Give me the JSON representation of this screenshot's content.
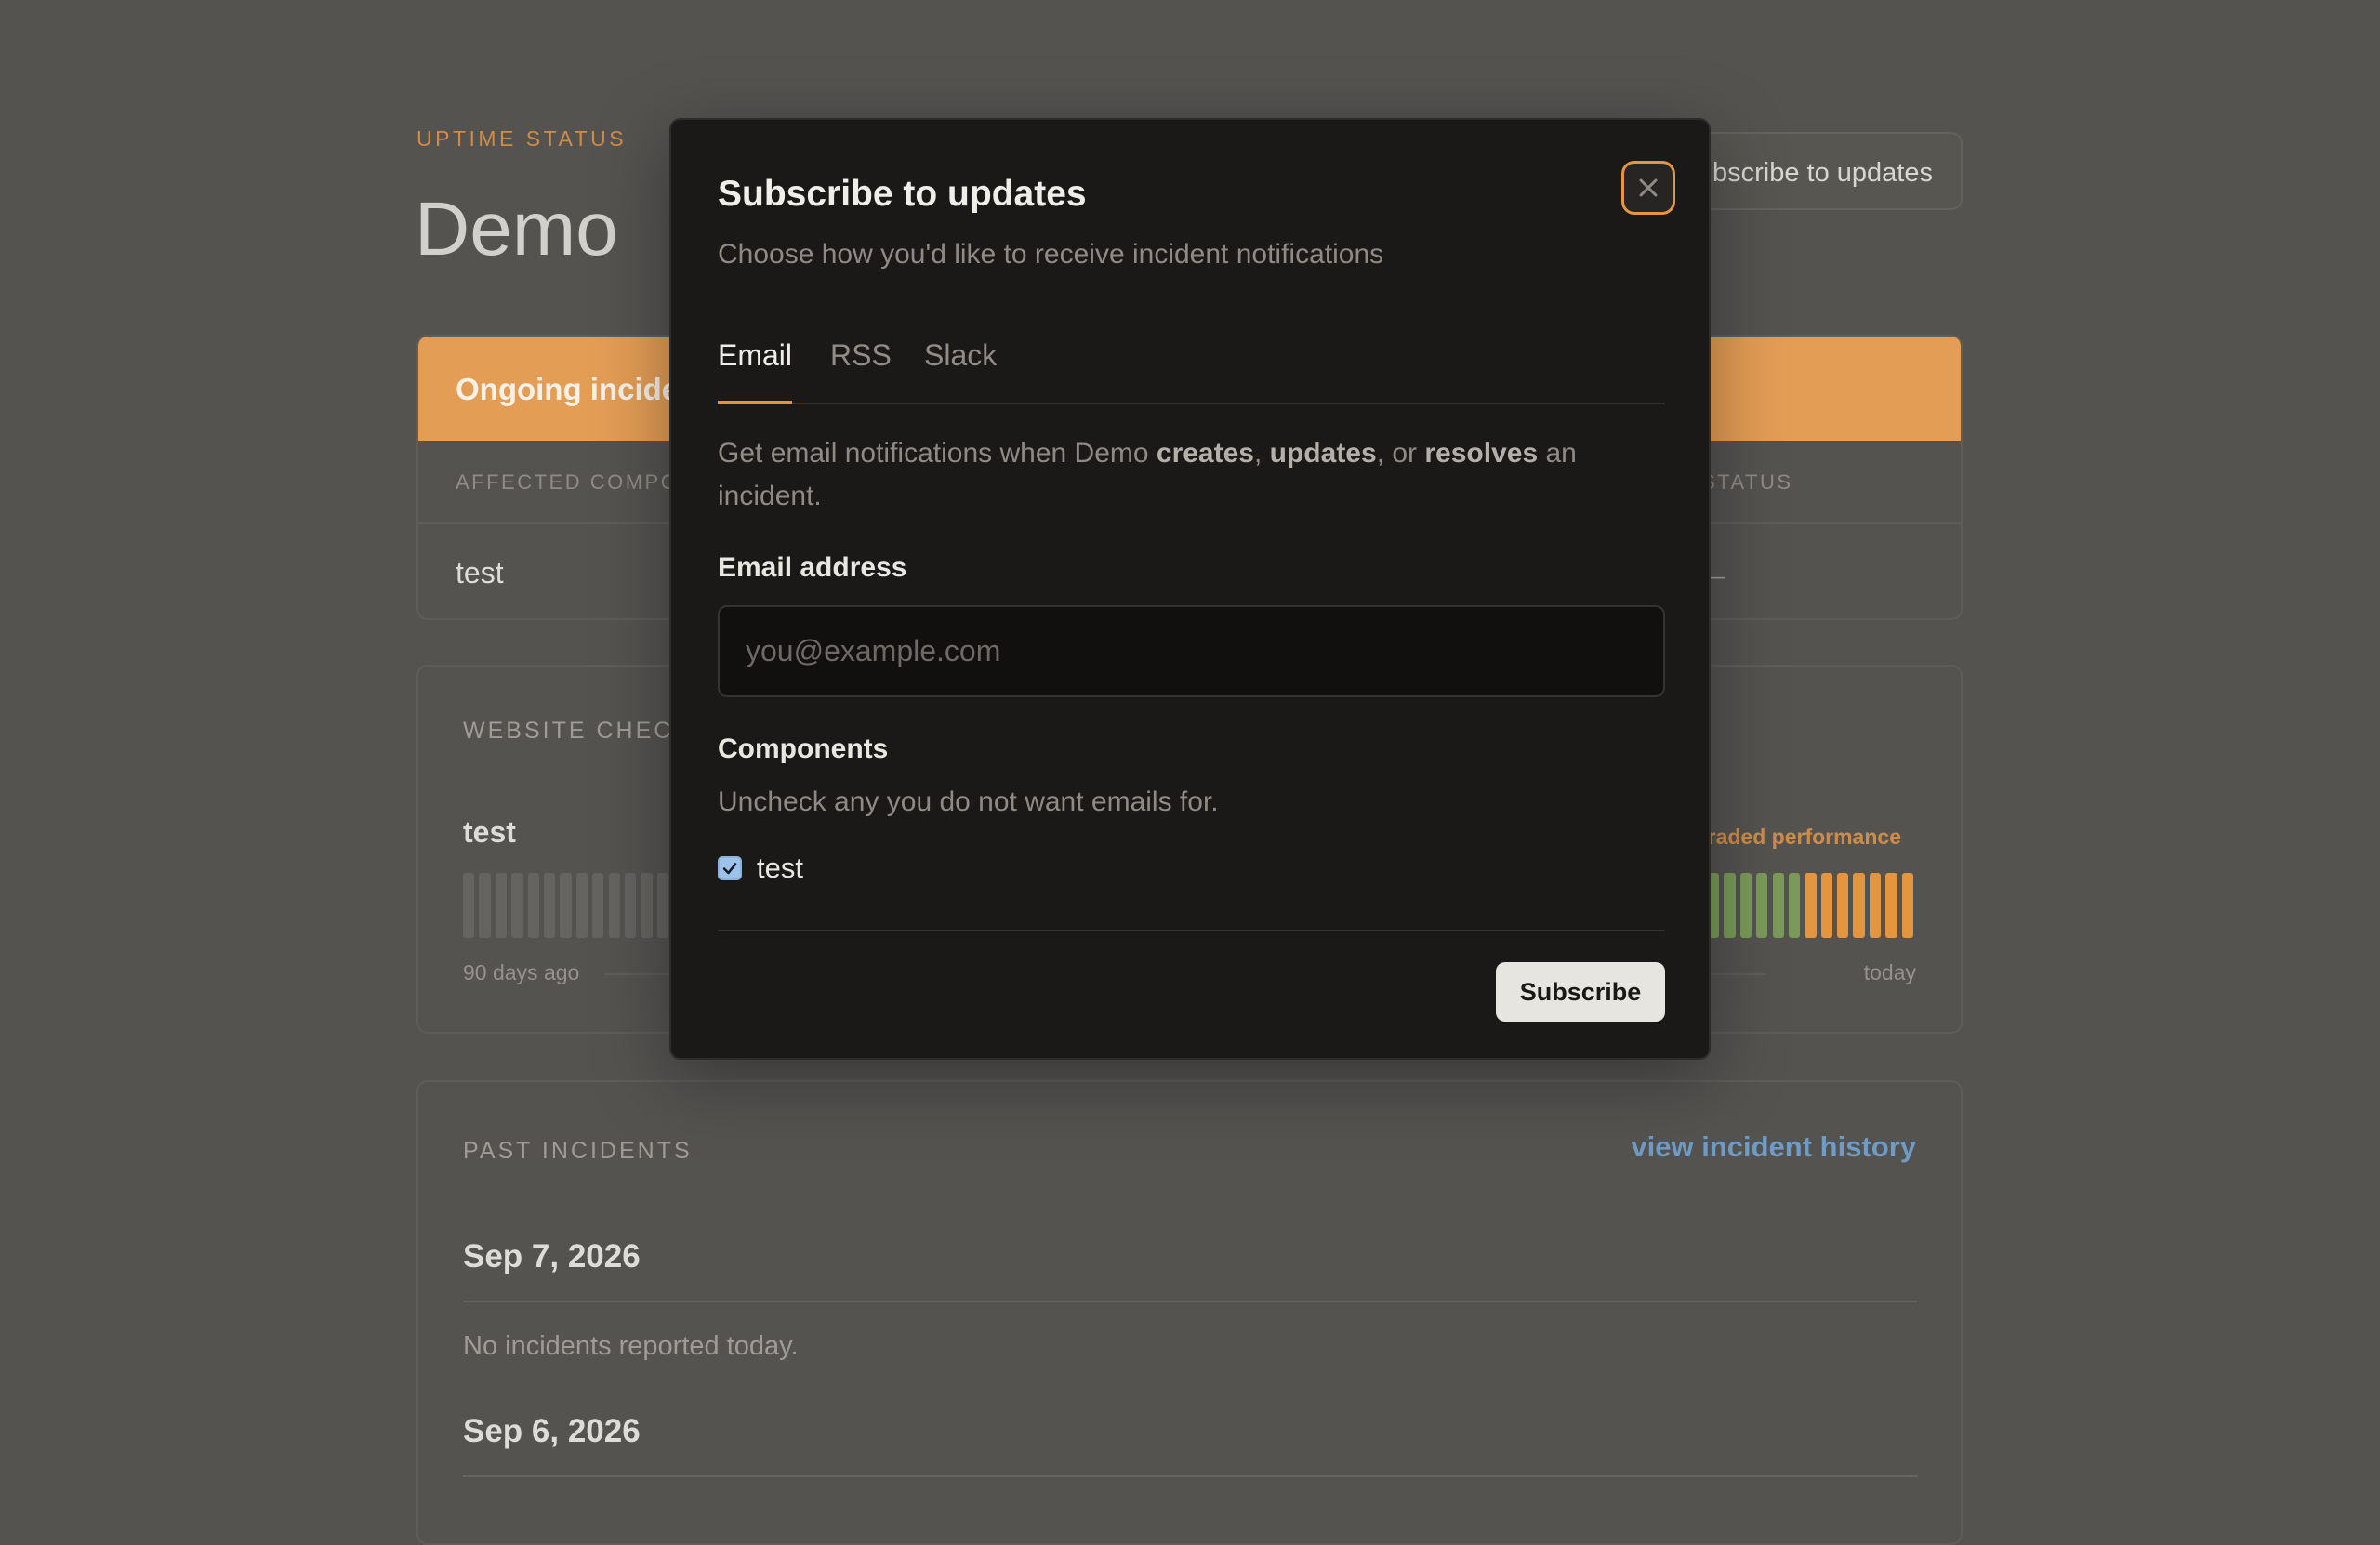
{
  "header": {
    "brand": "UPTIME STATUS",
    "title": "Demo",
    "subscribe_button": "Subscribe to updates"
  },
  "ongoing_incident": {
    "heading": "Ongoing incident",
    "columns": [
      "AFFECTED COMPONENTS",
      "STATUS"
    ],
    "rows": [
      {
        "component": "test",
        "status": "—"
      }
    ]
  },
  "website_checks": {
    "title": "WEBSITE CHECKS",
    "items": [
      {
        "name": "test",
        "status": "Degraded performance",
        "range_start": "90 days ago",
        "range_end": "today",
        "day_states": [
          "none",
          "none",
          "none",
          "none",
          "none",
          "none",
          "none",
          "none",
          "none",
          "none",
          "none",
          "none",
          "none",
          "none",
          "none",
          "none",
          "none",
          "none",
          "none",
          "none",
          "none",
          "none",
          "none",
          "none",
          "none",
          "none",
          "none",
          "none",
          "none",
          "none",
          "none",
          "none",
          "none",
          "none",
          "none",
          "none",
          "none",
          "none",
          "none",
          "none",
          "none",
          "none",
          "none",
          "none",
          "none",
          "none",
          "none",
          "none",
          "none",
          "none",
          "none",
          "none",
          "none",
          "none",
          "none",
          "none",
          "none",
          "none",
          "none",
          "none",
          "none",
          "none",
          "none",
          "none",
          "none",
          "none",
          "none",
          "none",
          "none",
          "none",
          "none",
          "none",
          "none",
          "none",
          "none",
          "none",
          "none",
          "up",
          "up",
          "up",
          "up",
          "up",
          "up",
          "degraded",
          "degraded",
          "degraded",
          "degraded",
          "degraded",
          "degraded",
          "degraded"
        ]
      }
    ]
  },
  "past_incidents": {
    "title": "PAST INCIDENTS",
    "history_link": "view incident history",
    "days": [
      {
        "date": "Sep 7, 2026",
        "note": "No incidents reported today."
      },
      {
        "date": "Sep 6, 2026",
        "note": ""
      }
    ]
  },
  "modal": {
    "title": "Subscribe to updates",
    "subtitle": "Choose how you'd like to receive incident notifications",
    "tabs": [
      {
        "label": "Email",
        "active": true
      },
      {
        "label": "RSS",
        "active": false
      },
      {
        "label": "Slack",
        "active": false
      }
    ],
    "description": {
      "prefix": "Get email notifications when Demo ",
      "creates": "creates",
      "sep1": ", ",
      "updates": "updates",
      "sep2": ", or ",
      "resolves": "resolves",
      "suffix": " an incident."
    },
    "email_label": "Email address",
    "email_placeholder": "you@example.com",
    "email_value": "",
    "components_label": "Components",
    "components_hint": "Uncheck any you do not want emails for.",
    "components": [
      {
        "name": "test",
        "checked": true
      }
    ],
    "submit_label": "Subscribe"
  },
  "colors": {
    "accent": "#e3963f",
    "up": "#7a9a5a",
    "degraded": "#e3963f",
    "none": "#666461",
    "link": "#6f9bc5"
  }
}
